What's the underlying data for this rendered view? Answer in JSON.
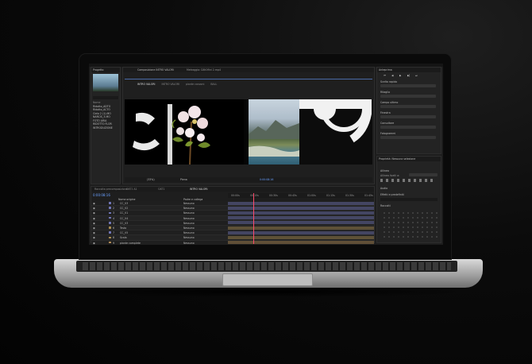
{
  "project_panel": {
    "title": "Progetto",
    "search_placeholder": "",
    "items": [
      "Nome",
      "Ridotto_ADTO",
      "Ridotto_ACTO",
      "Cielo 2 (1).MO",
      "NARCIS_3.MO",
      "FOTO ARIA",
      "RIDOTTO FLOR",
      "INTRODUZIONE"
    ]
  },
  "composition_panel": {
    "title": "Composizione INTRO VALORI",
    "tabs": [
      "INTRO VALORI",
      "INTRO VALORI",
      "piante canzoni",
      "BALL"
    ],
    "viewer_label": "Metraggio: DAY-Mini 2.mp4",
    "footer_zoom": "Piena",
    "footer_time": "0:00:08:16",
    "footer_view": "(33%)"
  },
  "right_panel": {
    "title": "Anteprima",
    "sections": [
      "Scelta rapida",
      "Ritaglio",
      "Campo ultimo",
      "Finestra",
      "Consultare",
      "Fotogrammi"
    ],
    "properties_title": "Proprietà: Nessuna selezione",
    "align_title": "Allinea",
    "align_sub": "Allinea livelli a:",
    "effects_title": "Effetti e predefiniti",
    "library_title": "Raccolti",
    "audio_label": "Audio"
  },
  "timeline": {
    "tabs": [
      "Raccolta precomposizione",
      "OAT1 A1",
      "OAT1",
      "INTRO VALORI"
    ],
    "current_time": "0:00:08:16",
    "columns": [
      "Nome origine",
      "Padre e collega"
    ],
    "layers": [
      {
        "num": "1",
        "name": "CC_V3",
        "color": "#6f74b4",
        "mode": "Nessuno"
      },
      {
        "num": "2",
        "name": "CC_V2",
        "color": "#6f74b4",
        "mode": "Nessuno"
      },
      {
        "num": "3",
        "name": "CC_V1",
        "color": "#6f74b4",
        "mode": "Nessuno"
      },
      {
        "num": "4",
        "name": "CC_V4",
        "color": "#6f74b4",
        "mode": "Nessuno"
      },
      {
        "num": "5",
        "name": "CC_V3",
        "color": "#6f74b4",
        "mode": "Nessuno"
      },
      {
        "num": "6",
        "name": "Testo",
        "color": "#a78a50",
        "mode": "Nessuno"
      },
      {
        "num": "7",
        "name": "CC_V5",
        "color": "#6f74b4",
        "mode": "Nessuno"
      },
      {
        "num": "8",
        "name": "Scala",
        "color": "#a78a50",
        "mode": "Nessuno"
      },
      {
        "num": "9",
        "name": "piante complete",
        "color": "#b08a55",
        "mode": "Nessuno"
      },
      {
        "num": "10",
        "name": "Scala",
        "color": "#a78a50",
        "mode": "Nessuno"
      }
    ],
    "ruler": [
      "00:00s",
      "00:15s",
      "00:30s",
      "00:45s",
      "01:00s",
      "01:15s",
      "01:30s",
      "01:45s"
    ]
  },
  "colors": {
    "accent": "#4a8cff",
    "playhead": "#ff4a6a",
    "screen_bg": "#1d1d1d"
  }
}
